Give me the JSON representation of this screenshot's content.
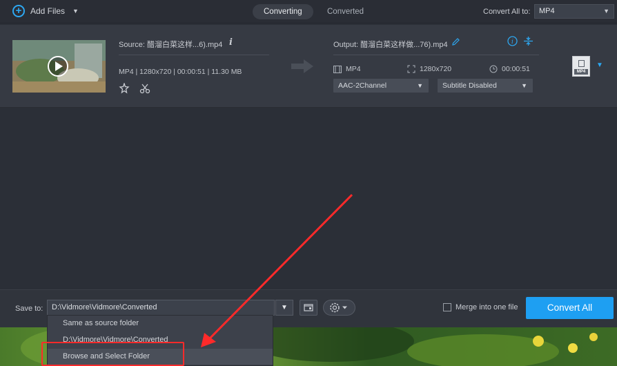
{
  "toolbar": {
    "add_files_label": "Add Files",
    "tabs": [
      {
        "label": "Converting",
        "active": true
      },
      {
        "label": "Converted",
        "active": false
      }
    ],
    "convert_all_to_label": "Convert All to:",
    "convert_all_format": "MP4"
  },
  "file_item": {
    "source_name": "Source: 醋溜白菜这样...6).mp4",
    "source_meta": "MP4 | 1280x720 | 00:00:51 | 11.30 MB",
    "output_name": "Output: 醋溜白菜这样做...76).mp4",
    "output_format": "MP4",
    "output_resolution": "1280x720",
    "output_duration": "00:00:51",
    "audio_track": "AAC-2Channel",
    "subtitle": "Subtitle Disabled",
    "format_badge": "MP4"
  },
  "bottom": {
    "save_to_label": "Save to:",
    "save_path": "D:\\Vidmore\\Vidmore\\Converted",
    "merge_label": "Merge into one file",
    "merge_checked": false,
    "convert_all_label": "Convert All"
  },
  "save_dropdown": {
    "options": [
      "Same as source folder",
      "D:\\Vidmore\\Vidmore\\Converted",
      "Browse and Select Folder"
    ],
    "highlighted_index": 2
  },
  "colors": {
    "accent": "#1e9ff2",
    "annotation": "#ff2a2a",
    "background": "#2b2f37"
  }
}
